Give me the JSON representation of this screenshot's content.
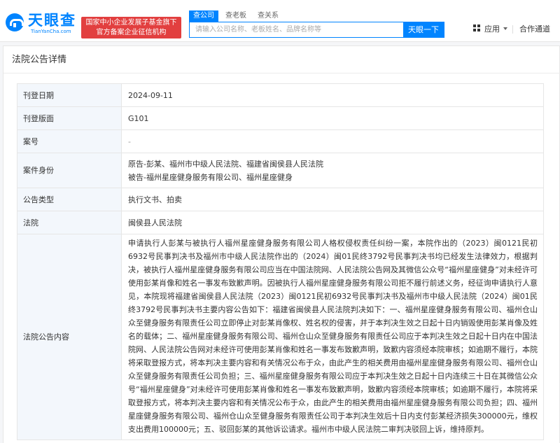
{
  "header": {
    "logo_text": "天眼查",
    "logo_sub": "TianYanCha.com",
    "badge_line1": "国家中小企业发展子基金旗下",
    "badge_line2": "官方备案企业征信机构",
    "tabs": [
      {
        "label": "查公司",
        "active": true
      },
      {
        "label": "查老板",
        "active": false
      },
      {
        "label": "查关系",
        "active": false
      }
    ],
    "search_placeholder": "请输入公司名称、老板姓名、品牌名称等",
    "search_button": "天眼一下",
    "apps_label": "应用",
    "partner_label": "合作通道"
  },
  "page": {
    "title": "法院公告详情"
  },
  "details": [
    {
      "label": "刊登日期",
      "value": "2024-09-11"
    },
    {
      "label": "刊登版面",
      "value": "G101"
    },
    {
      "label": "案号",
      "value": "-"
    },
    {
      "label": "案件身份",
      "value_lines": [
        "原告-彭某、福州市中级人民法院、福建省闽侯县人民法院",
        "被告-福州星座健身服务有限公司、福州星座健身"
      ]
    },
    {
      "label": "公告类型",
      "value": "执行文书、拍卖"
    },
    {
      "label": "法院",
      "value": "闽侯县人民法院"
    },
    {
      "label": "法院公告内容",
      "value": "申请执行人彭某与被执行人福州星座健身服务有限公司人格权侵权责任纠纷一案，本院作出的（2023）闽0121民初6932号民事判决书及福州市中级人民法院作出的（2024）闽01民终3792号民事判决书均已经发生法律效力，根据判决，被执行人福州星座健身服务有限公司应当在中国法院网、人民法院公告网及其微信公众号“福州星座健身”对未经许可使用彭某肖像和姓名一事发布致歉声明。因被执行人福州星座健身服务有限公司拒不履行前述义务，经征询申请执行人意见，本院现将福建省闽侯县人民法院（2023）闽0121民初6932号民事判决书及福州市中级人民法院（2024）闽01民终3792号民事判决书主要内容公告如下：福建省闽侯县人民法院判决如下：一、福州星座健身服务有限公司、福州仓山众至健身服务有限责任公司立即停止对彭某肖像权、姓名权的侵害，并于本判决生效之日起十日内销毁使用彭某肖像及姓名的载体；二、福州星座健身服务有限公司、福州仓山众至健身服务有限责任公司应于本判决生效之日起十日内在中国法院网、人民法院公告网对未经许可使用彭某肖像和姓名一事发布致歉声明，致歉内容须经本院审核；如逾期不履行，本院将采取登报方式，将本判决主要内容和有关情况公布于众，由此产生的相关费用由福州星座健身服务有限公司、福州仓山众至健身服务有限责任公司负担；三、福州星座健身服务有限公司应于本判决生效之日起十日内连续三十日在其微信公众号“福州星座健身”对未经许可使用彭某肖像和姓名一事发布致歉声明，致歉内容须经本院审核；如逾期不履行，本院将采取登报方式，将本判决主要内容和有关情况公布于众，由此产生的相关费用由福州星座健身服务有限公司负担；四、福州星座健身服务有限公司、福州仓山众至健身服务有限责任公司于本判决生效后十日内支付彭某经济损失300000元，维权支出费用100000元；五、驳回彭某的其他诉讼请求。福州市中级人民法院二审判决驳回上诉，维持原判。"
    }
  ],
  "colors": {
    "brand": "#0084ff",
    "badge": "#e23f3f",
    "label_bg": "#f3f7fc"
  }
}
